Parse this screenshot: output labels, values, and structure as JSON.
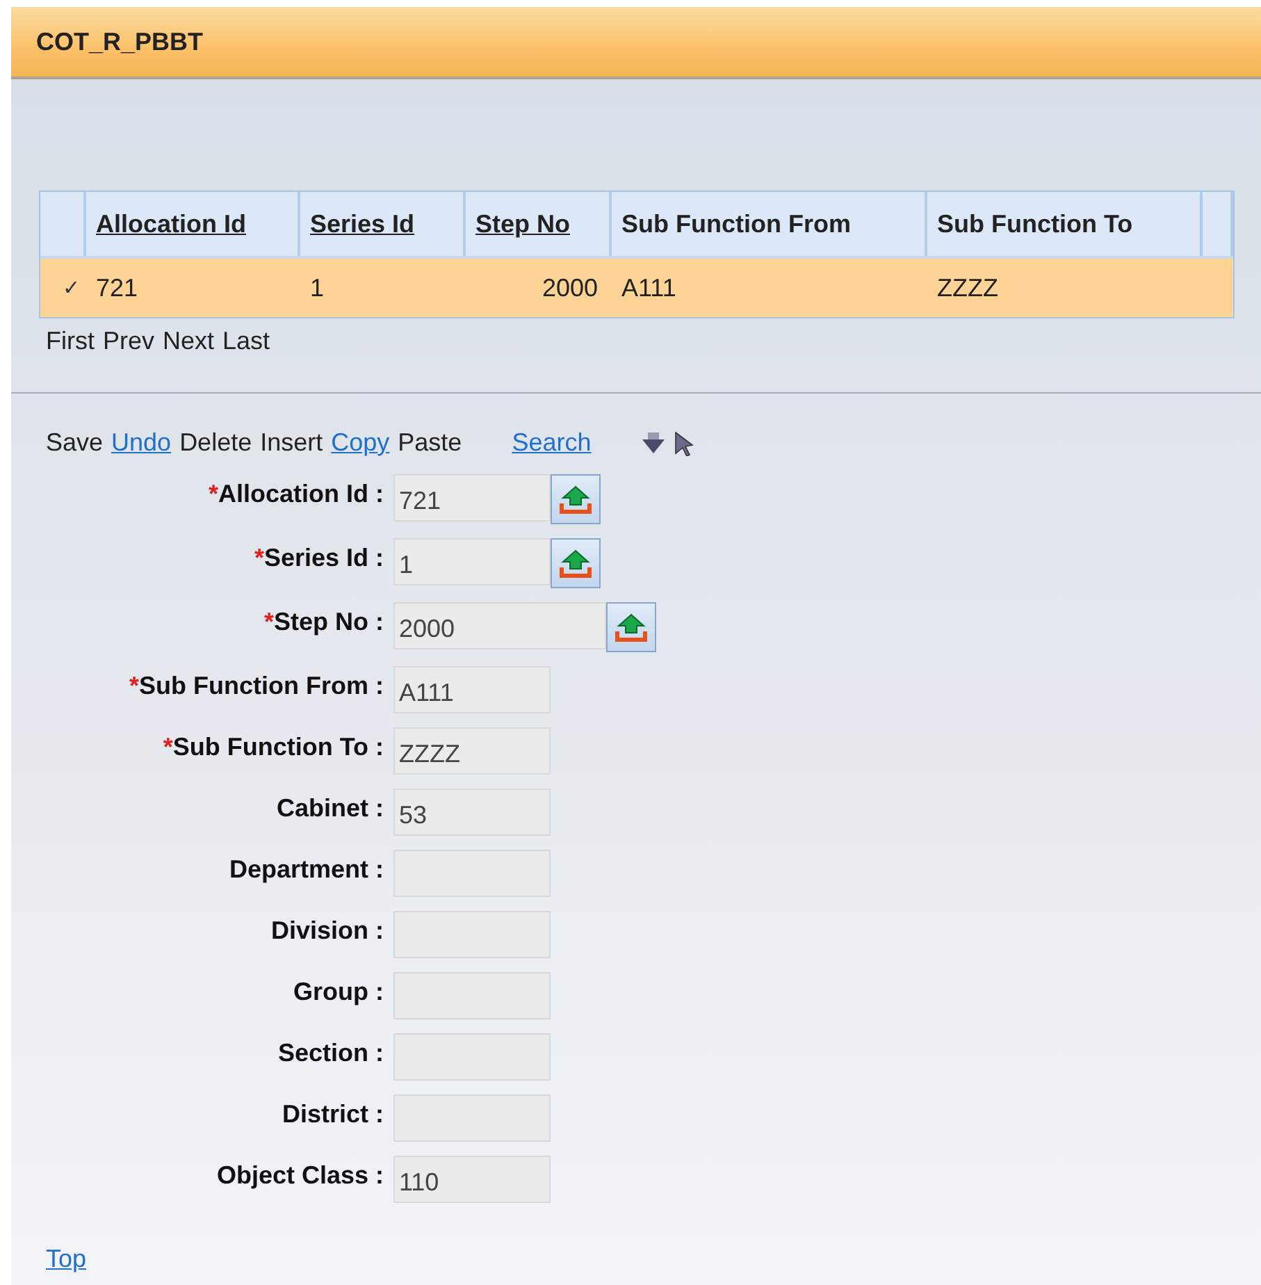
{
  "window": {
    "title": "COT_R_PBBT"
  },
  "table": {
    "columns": [
      {
        "label": "Allocation Id",
        "sortable": true,
        "kind": "text"
      },
      {
        "label": "Series Id",
        "sortable": true,
        "kind": "text"
      },
      {
        "label": "Step No",
        "sortable": true,
        "kind": "number"
      },
      {
        "label": "Sub Function From",
        "sortable": false,
        "kind": "text"
      },
      {
        "label": "Sub Function To",
        "sortable": false,
        "kind": "text"
      }
    ],
    "rows": [
      {
        "selected": true,
        "mark": "✓",
        "cells": [
          "721",
          "1",
          "2000",
          "A111",
          "ZZZZ"
        ]
      }
    ]
  },
  "pager": [
    "First",
    "Prev",
    "Next",
    "Last"
  ],
  "actions": [
    {
      "label": "Save",
      "kind": "plain"
    },
    {
      "label": "Undo",
      "kind": "link"
    },
    {
      "label": "Delete",
      "kind": "plain"
    },
    {
      "label": "Insert",
      "kind": "plain"
    },
    {
      "label": "Copy",
      "kind": "link"
    },
    {
      "label": "Paste",
      "kind": "plain"
    },
    {
      "label": "Search",
      "kind": "link"
    }
  ],
  "fields": [
    {
      "label": "Allocation Id :",
      "value": "721",
      "required": true,
      "lookup": true
    },
    {
      "label": "Series Id :",
      "value": "1",
      "required": true,
      "lookup": true
    },
    {
      "label": "Step No :",
      "value": "2000",
      "required": true,
      "lookup": true
    },
    {
      "label": "Sub Function From :",
      "value": "A111",
      "required": true,
      "lookup": false
    },
    {
      "label": "Sub Function To :",
      "value": "ZZZZ",
      "required": true,
      "lookup": false
    },
    {
      "label": "Cabinet :",
      "value": "53",
      "required": false,
      "lookup": false
    },
    {
      "label": "Department :",
      "required": false,
      "lookup": false
    },
    {
      "label": "Division :",
      "required": false,
      "lookup": false
    },
    {
      "label": "Group :",
      "required": false,
      "lookup": false
    },
    {
      "label": "Section :",
      "required": false,
      "lookup": false
    },
    {
      "label": "District :",
      "required": false,
      "lookup": false
    },
    {
      "label": "Object Class :",
      "value": "110",
      "required": false,
      "lookup": false
    }
  ],
  "required_mark": "*",
  "footer_link": "Top"
}
